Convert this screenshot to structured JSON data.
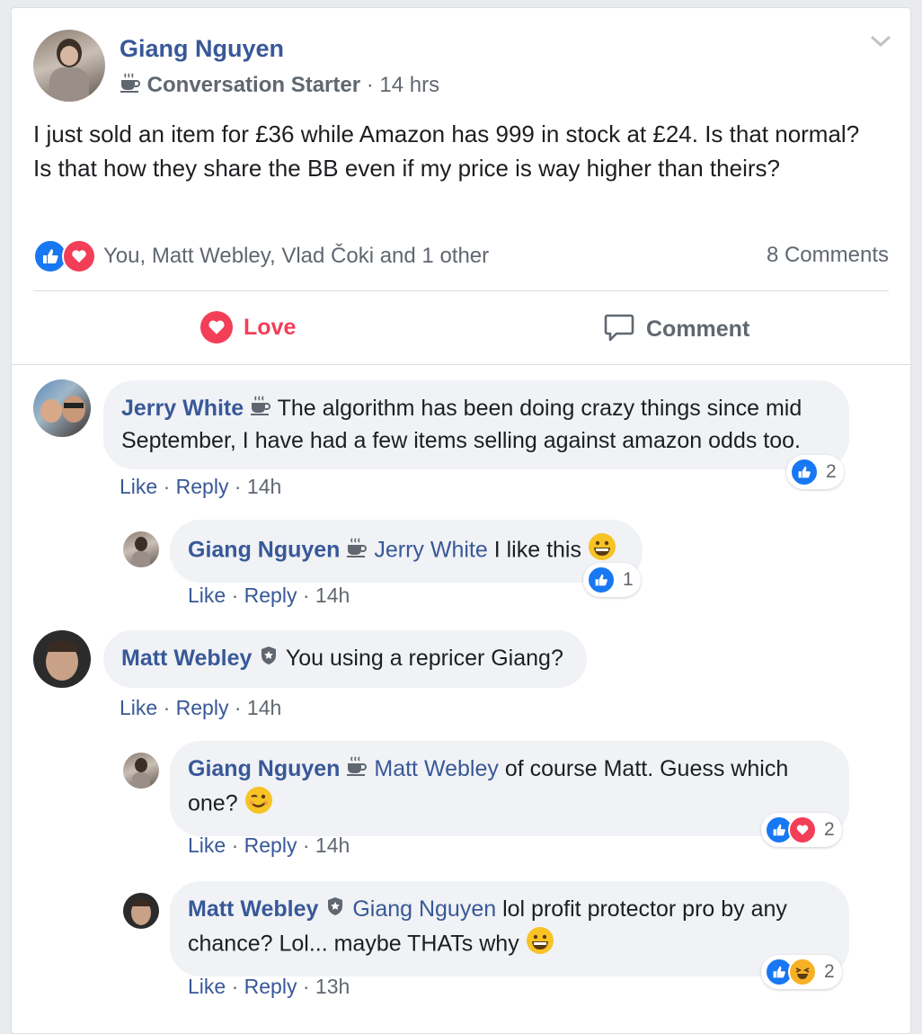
{
  "post": {
    "author": "Giang Nguyen",
    "badge": "Conversation Starter",
    "time": "· 14 hrs",
    "text": "I just sold an item for £36 while Amazon has 999 in stock at £24. Is that normal? Is that how they share the BB even if my price is way higher than theirs?",
    "reactors": "You, Matt Webley, Vlad Čoki and 1 other",
    "comments_count": "8 Comments",
    "love_label": "Love",
    "comment_label": "Comment"
  },
  "comments": [
    {
      "author": "Jerry White",
      "text": "The algorithm has been doing crazy things since mid September, I have had a few items selling against amazon odds too.",
      "like": "Like",
      "reply": "Reply",
      "time": "14h",
      "reactions": "2"
    },
    {
      "author": "Giang Nguyen",
      "mention": "Jerry White",
      "text": "I like this",
      "like": "Like",
      "reply": "Reply",
      "time": "14h",
      "reactions": "1"
    },
    {
      "author": "Matt Webley",
      "text": "You using a repricer Giang?",
      "like": "Like",
      "reply": "Reply",
      "time": "14h"
    },
    {
      "author": "Giang Nguyen",
      "mention": "Matt Webley",
      "text": "of course Matt. Guess which one?",
      "like": "Like",
      "reply": "Reply",
      "time": "14h",
      "reactions": "2"
    },
    {
      "author": "Matt Webley",
      "mention": "Giang Nguyen",
      "text": "lol profit protector pro by any chance? Lol... maybe THATs why",
      "like": "Like",
      "reply": "Reply",
      "time": "13h",
      "reactions": "2"
    }
  ],
  "colors": {
    "name_blue": "#385898",
    "love_red": "#f33e58",
    "like_blue": "#1877f2",
    "bubble_gray": "#f0f2f5"
  }
}
